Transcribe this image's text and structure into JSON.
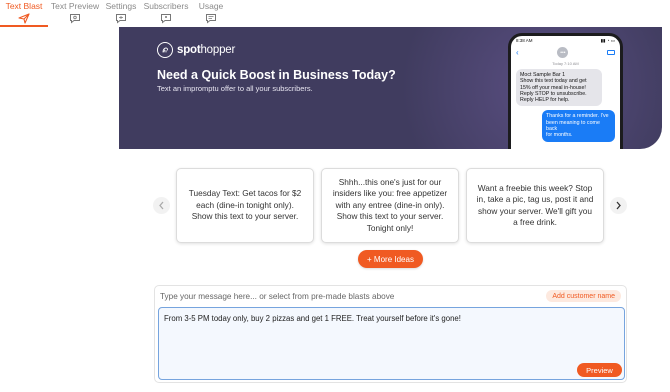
{
  "tabs": [
    {
      "label": "Text Blast",
      "icon": "send-icon",
      "active": true
    },
    {
      "label": "Text Preview",
      "icon": "chat-preview-icon",
      "active": false
    },
    {
      "label": "Settings",
      "icon": "chat-settings-icon",
      "active": false
    },
    {
      "label": "Subscribers",
      "icon": "chat-subscribers-icon",
      "active": false
    },
    {
      "label": "Usage",
      "icon": "chat-usage-icon",
      "active": false
    }
  ],
  "banner": {
    "logo_bold": "spot",
    "logo_light": "hopper",
    "title": "Need a Quick Boost in Business Today?",
    "subtitle": "Text an impromptu offer to all your subscribers."
  },
  "phone": {
    "status_time": "8:38 AM",
    "thread_time": "Today 7:10 AM",
    "incoming": "Moct Sample Bar 1\nShow this text today and get 15% off your meal in-house! Reply STOP to unsubscribe. Reply HELP for help.",
    "incoming_lines": [
      "Moct Sample Bar 1",
      "Show this text today and get",
      "15% off your meal in-house!",
      "Reply STOP to unsubscribe.",
      "Reply HELP for help."
    ],
    "outgoing_lines": [
      "Thanks for a reminder. I've",
      "been meaning to come back",
      "for months."
    ]
  },
  "ideas": [
    "Tuesday Text: Get tacos for $2 each (dine-in tonight only). Show this text to your server.",
    "Shhh...this one's just for our insiders like you: free appetizer with any entree (dine-in only). Show this text to your server. Tonight only!",
    "Want a freebie this week? Stop in, take a pic, tag us, post it and show your server. We'll gift you a free drink."
  ],
  "more_ideas_label": "+ More Ideas",
  "composer": {
    "label": "Type your message here... or select from pre-made blasts above",
    "add_name_label": "Add customer name",
    "message": "From 3-5 PM today only, buy 2 pizzas and get 1 FREE. Treat yourself before it's gone!",
    "preview_label": "Preview"
  },
  "colors": {
    "accent": "#f05a22",
    "banner_bg": "#403c5f",
    "imessage_blue": "#1a7cf6"
  }
}
